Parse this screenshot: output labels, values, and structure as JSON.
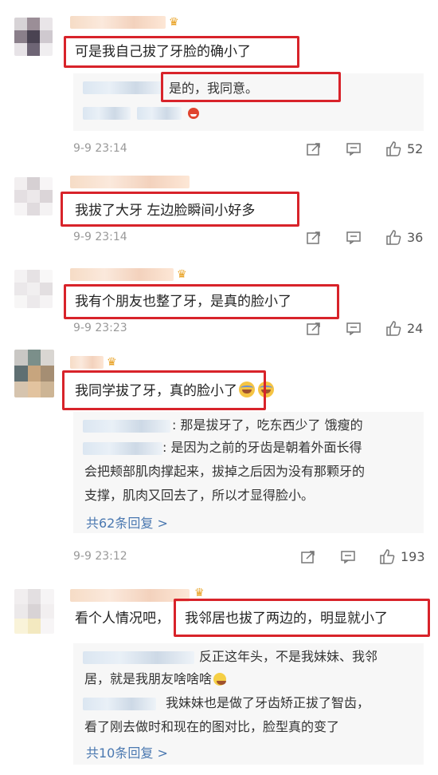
{
  "comments": [
    {
      "text": "可是我自己拔了牙脸的确小了",
      "reply_text": "是的，我同意。",
      "time": "9-9 23:14",
      "likes": "52"
    },
    {
      "text": "我拔了大牙 左边脸瞬间小好多",
      "time": "9-9 23:14",
      "likes": "36"
    },
    {
      "text": "我有个朋友也整了牙，是真的脸小了",
      "time": "9-9 23:23",
      "likes": "24"
    },
    {
      "text": "我同学拔了牙，真的脸小了",
      "replies": [
        ": 那是拔牙了，吃东西少了  饿瘦的",
        ": 是因为之前的牙齿是朝着外面长得",
        "会把颊部肌肉撑起来，拔掉之后因为没有那颗牙的",
        "支撑，肌肉又回去了，所以才显得脸小。"
      ],
      "more": "共62条回复 >",
      "time": "9-9 23:12",
      "likes": "193"
    },
    {
      "text_prefix": "看个人情况吧，",
      "text": "我邻居也拔了两边的，明显就小了",
      "replies": [
        "反正这年头，不是我妹妹、我邻",
        "居，就是我朋友啥啥啥",
        "我妹妹也是做了牙齿矫正拔了智齿，",
        "看了刚去做时和现在的图对比，脸型真的变了"
      ],
      "more": "共10条回复 >"
    }
  ],
  "icons": {
    "share": "share-icon",
    "comment": "comment-icon",
    "like": "thumbs-up-icon",
    "crown": "crown-icon"
  },
  "colors": {
    "highlight": "#d8232a",
    "link": "#4a78b0",
    "meta": "#999999"
  }
}
